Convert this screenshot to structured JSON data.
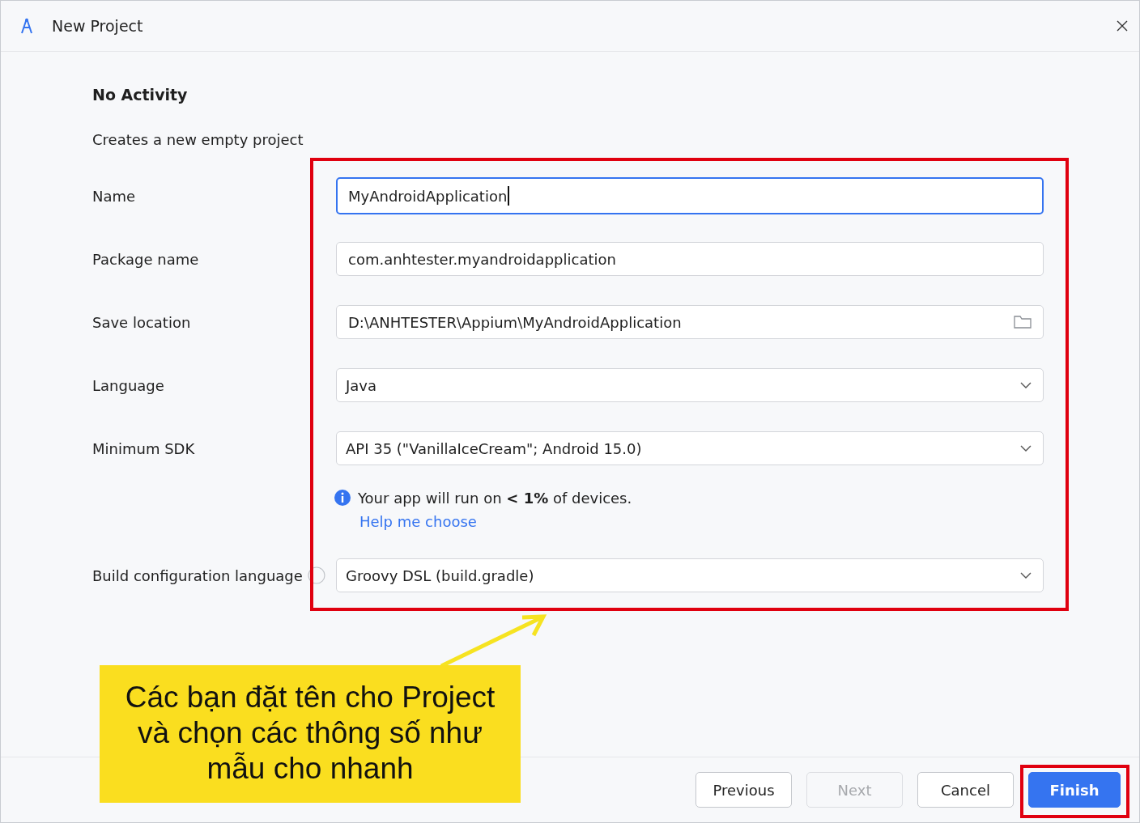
{
  "window": {
    "title": "New Project"
  },
  "template": {
    "title": "No Activity",
    "description": "Creates a new empty project"
  },
  "fields": [
    {
      "kind": "text",
      "label": "Name",
      "value": "MyAndroidApplication",
      "focused": true
    },
    {
      "kind": "text",
      "label": "Package name",
      "value": "com.anhtester.myandroidapplication",
      "focused": false
    },
    {
      "kind": "folder",
      "label": "Save location",
      "value": "D:\\ANHTESTER\\Appium\\MyAndroidApplication",
      "focused": false
    },
    {
      "kind": "dropdown",
      "label": "Language",
      "value": "Java",
      "focused": false
    },
    {
      "kind": "dropdown",
      "label": "Minimum SDK",
      "value": "API 35 (\"VanillaIceCream\"; Android 15.0)",
      "focused": false,
      "note": {
        "text": "Your app will run on **< 1%** of devices.",
        "link": "Help me choose"
      }
    },
    {
      "kind": "dropdown",
      "label": "Build configuration language",
      "value": "Groovy DSL (build.gradle)",
      "focused": false,
      "help": true
    }
  ],
  "buttons": [
    {
      "label": "Previous",
      "kind": "normal",
      "disabled": false
    },
    {
      "label": "Next",
      "kind": "normal",
      "disabled": true
    },
    {
      "label": "Cancel",
      "kind": "normal",
      "disabled": false
    },
    {
      "label": "Finish",
      "kind": "primary",
      "disabled": false
    }
  ],
  "annotation": {
    "callout": "Các bạn đặt tên cho Project và chọn các thông số như mẫu cho nhanh"
  }
}
